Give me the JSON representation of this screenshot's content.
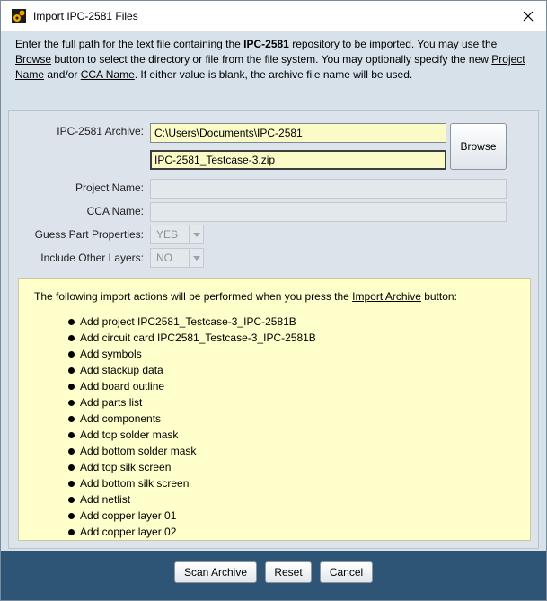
{
  "window": {
    "title": "Import IPC-2581 Files"
  },
  "description": {
    "p1": "Enter the full path for the text file containing the ",
    "b1": "IPC-2581",
    "p2": " repository to be imported. You may use the ",
    "u_browse": "Browse",
    "p3": " button to select the directory or file from the file system. You may optionally specify the new ",
    "u_project": "Project Name",
    "p4": " and/or ",
    "u_cca": "CCA Name",
    "p5": ". If either value is blank, the archive file name will be used."
  },
  "form": {
    "archive_label": "IPC-2581 Archive:",
    "archive_path": "C:\\Users\\Documents\\IPC-2581",
    "archive_file": "IPC-2581_Testcase-3.zip",
    "browse_label": "Browse",
    "project_label": "Project Name:",
    "project_value": "",
    "cca_label": "CCA Name:",
    "cca_value": "",
    "guess_label": "Guess Part Properties:",
    "guess_value": "YES",
    "layers_label": "Include Other Layers:",
    "layers_value": "NO"
  },
  "actions": {
    "intro_pre": "The following import actions will be performed when you press the ",
    "intro_link": "Import Archive",
    "intro_post": " button:",
    "items": [
      "Add project IPC2581_Testcase-3_IPC-2581B",
      "Add circuit card IPC2581_Testcase-3_IPC-2581B",
      "Add symbols",
      "Add stackup data",
      "Add board outline",
      "Add parts list",
      "Add components",
      "Add top solder mask",
      "Add bottom solder mask",
      "Add top silk screen",
      "Add bottom silk screen",
      "Add netlist",
      "Add copper layer 01",
      "Add copper layer 02"
    ]
  },
  "footer": {
    "scan_label": "Scan Archive",
    "reset_label": "Reset",
    "cancel_label": "Cancel"
  },
  "colors": {
    "footer_bg": "#2e5576",
    "panel_bg": "#dce3ea",
    "field_bg": "#fbfbc8",
    "actions_bg": "#ffffcc"
  }
}
